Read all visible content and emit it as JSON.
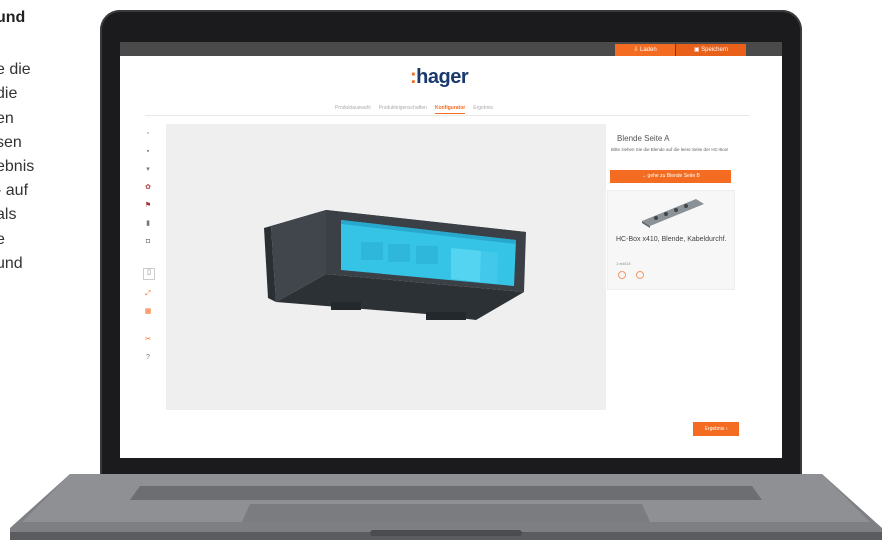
{
  "left_text": {
    "heading": "und",
    "lines": [
      "e die",
      "die",
      "en",
      "sen",
      "ebnis",
      "- auf",
      "als",
      "e",
      "und"
    ]
  },
  "app": {
    "topbar": {
      "load_label": "⇩ Laden",
      "save_label": "▣ Speichern"
    },
    "logo": {
      "colon": ":",
      "text": "hager"
    },
    "tabs": [
      {
        "label": "Produktauswahl",
        "active": false
      },
      {
        "label": "Produkteigenschaften",
        "active": false
      },
      {
        "label": "Konfigurator",
        "active": true
      },
      {
        "label": "Ergebnis",
        "active": false
      }
    ],
    "sidebar_icons": [
      "panel-icon",
      "cabinet-icon",
      "cup-icon",
      "flower-icon",
      "flag-icon",
      "chart-icon",
      "cube-icon",
      "frame-icon",
      "ruler-icon",
      "grid-icon",
      "cut-icon",
      "help-icon"
    ],
    "panel": {
      "title": "Blende Seite A",
      "description": "Bitte ziehen Sie die Blende auf die leere Seite der HC-Box!",
      "button_label": "→     gehe zu Blende Seite B",
      "product_name": "HC-Box x410, Blende, Kabeldurchf.",
      "product_code": "1 ed413"
    },
    "result_button": "Ergebnis  ›"
  },
  "colors": {
    "accent": "#f36c21",
    "logo": "#1a3a6e",
    "topbar": "#4a4a4a",
    "box_body": "#3a4046",
    "box_face": "#35c4e6"
  }
}
